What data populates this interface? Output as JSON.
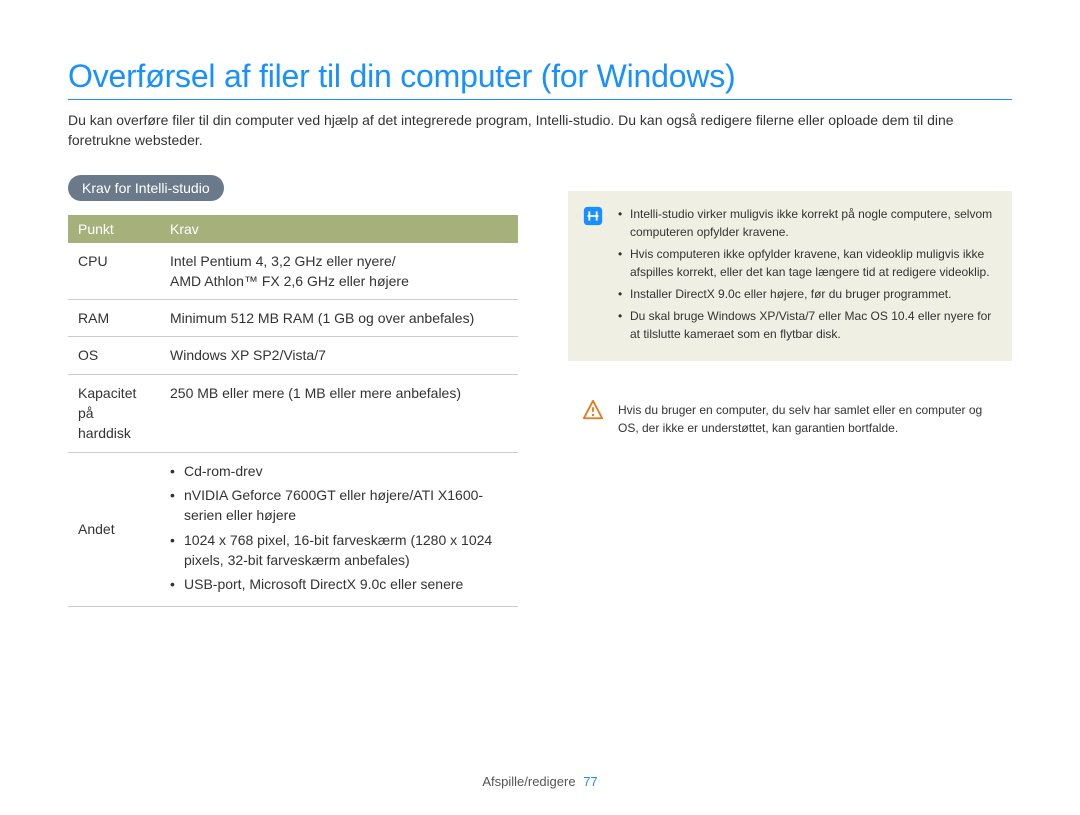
{
  "title": "Overførsel af filer til din computer (for Windows)",
  "intro": "Du kan overføre filer til din computer ved hjælp af det integrerede program, Intelli-studio. Du kan også redigere filerne eller oploade dem til dine foretrukne websteder.",
  "section_heading": "Krav for Intelli-studio",
  "table": {
    "header": {
      "col1": "Punkt",
      "col2": "Krav"
    },
    "rows": {
      "cpu": {
        "label": "CPU",
        "value": "Intel Pentium 4, 3,2 GHz eller nyere/\nAMD Athlon™ FX 2,6 GHz eller højere"
      },
      "ram": {
        "label": "RAM",
        "value": "Minimum 512 MB RAM (1 GB og over anbefales)"
      },
      "os": {
        "label": "OS",
        "value": "Windows XP SP2/Vista/7"
      },
      "disk": {
        "label": "Kapacitet på harddisk",
        "value": "250 MB eller mere (1 MB eller mere anbefales)"
      },
      "other": {
        "label": "Andet",
        "items": [
          "Cd-rom-drev",
          "nVIDIA Geforce 7600GT eller højere/ATI X1600-serien eller højere",
          "1024 x 768 pixel, 16-bit farveskærm (1280 x 1024 pixels, 32-bit farveskærm anbefales)",
          "USB-port, Microsoft DirectX 9.0c eller senere"
        ]
      }
    }
  },
  "note_items": [
    "Intelli-studio virker muligvis ikke korrekt på nogle computere, selvom computeren opfylder kravene.",
    "Hvis computeren ikke opfylder kravene, kan videoklip muligvis ikke afspilles korrekt, eller det kan tage længere tid at redigere videoklip.",
    "Installer DirectX 9.0c eller højere, før du bruger programmet.",
    "Du skal bruge Windows XP/Vista/7 eller Mac OS 10.4 eller nyere for at tilslutte kameraet som en flytbar disk."
  ],
  "warn_text": "Hvis du bruger en computer, du selv har samlet eller en computer og OS, der ikke er understøttet, kan garantien bortfalde.",
  "footer": {
    "section": "Afspille/redigere",
    "page": "77"
  }
}
